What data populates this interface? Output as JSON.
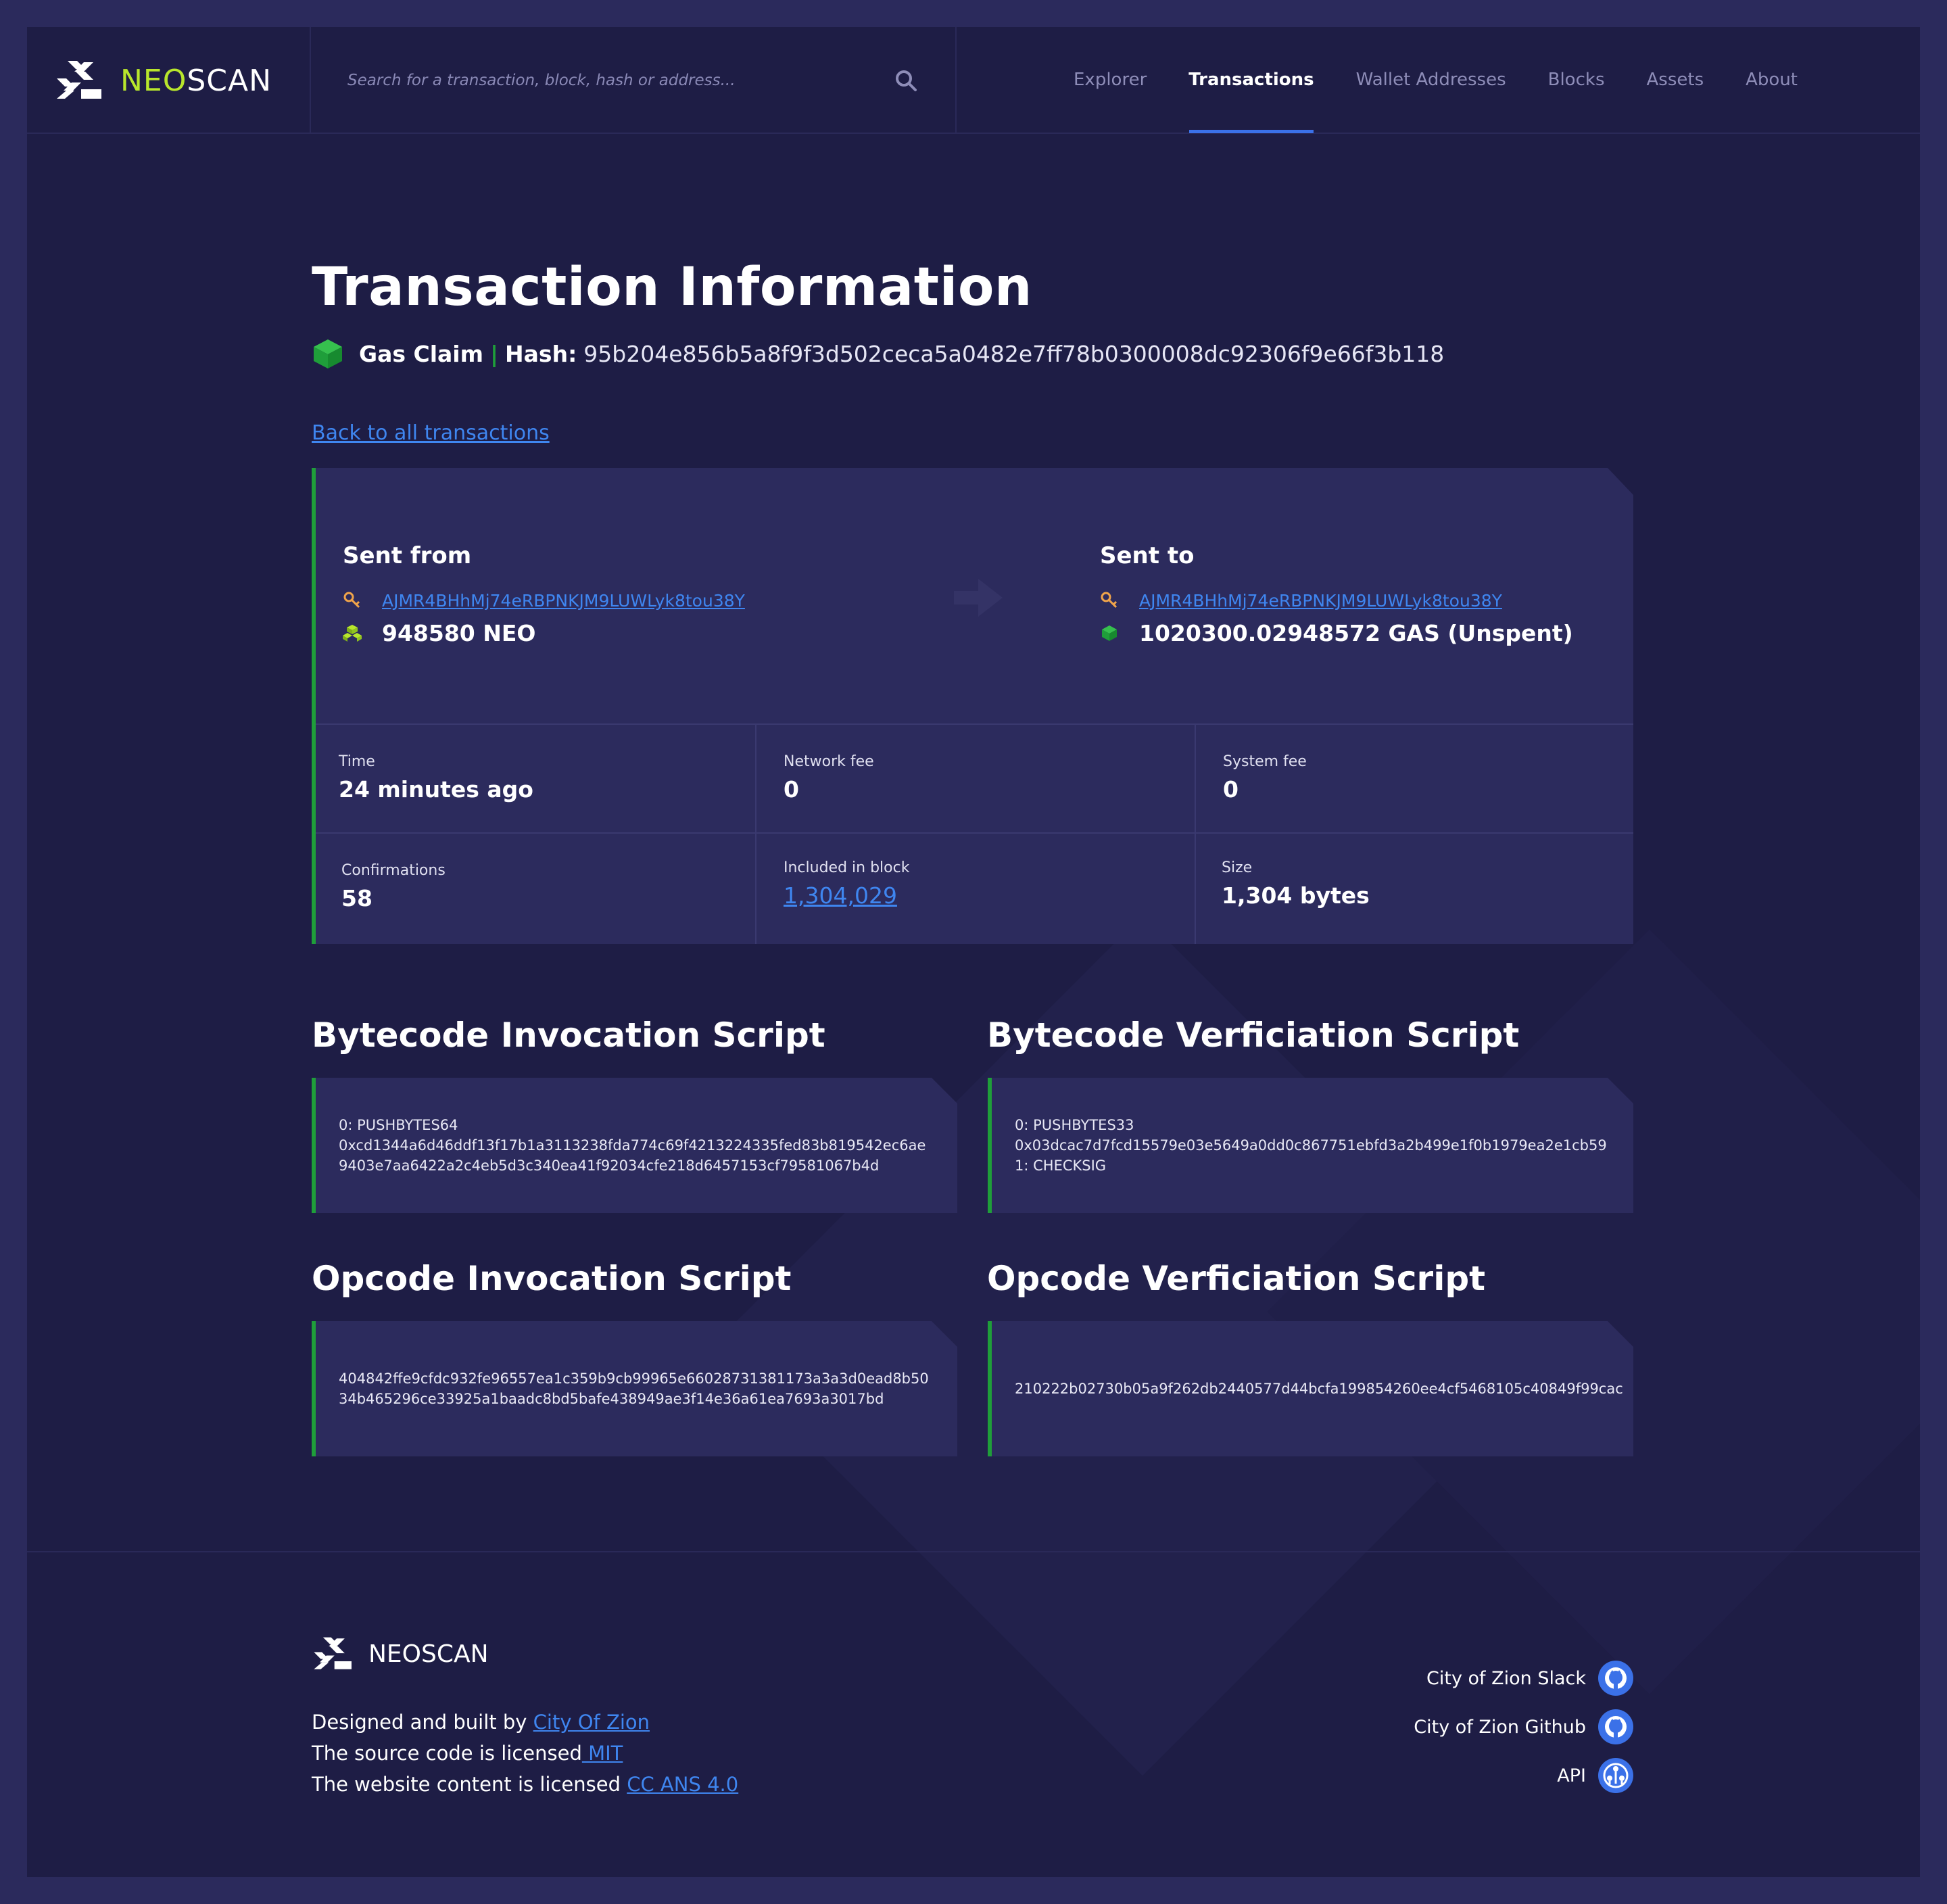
{
  "brand": {
    "neo": "NEO",
    "scan": "SCAN"
  },
  "search": {
    "placeholder": "Search for a transaction, block, hash or address..."
  },
  "nav": [
    {
      "label": "Explorer",
      "active": false
    },
    {
      "label": "Transactions",
      "active": true
    },
    {
      "label": "Wallet Addresses",
      "active": false
    },
    {
      "label": "Blocks",
      "active": false
    },
    {
      "label": "Assets",
      "active": false
    },
    {
      "label": "About",
      "active": false
    }
  ],
  "page": {
    "title": "Transaction Information",
    "type": "Gas Claim",
    "separator": "|",
    "hash_label": "Hash:",
    "hash": "95b204e856b5a8f9f3d502ceca5a0482e7ff78b0300008dc92306f9e66f3b118",
    "back_link": "Back to all transactions"
  },
  "transfer": {
    "from": {
      "label": "Sent from",
      "address": "AJMR4BHhMj74eRBPNKJM9LUWLyk8tou38Y",
      "amount": "948580 NEO"
    },
    "to": {
      "label": "Sent to",
      "address": "AJMR4BHhMj74eRBPNKJM9LUWLyk8tou38Y",
      "amount": "1020300.02948572 GAS (Unspent)"
    }
  },
  "details": {
    "time": {
      "label": "Time",
      "value": "24 minutes ago"
    },
    "network_fee": {
      "label": "Network fee",
      "value": "0"
    },
    "system_fee": {
      "label": "System fee",
      "value": "0"
    },
    "confirmations": {
      "label": "Confirmations",
      "value": "58"
    },
    "block": {
      "label": "Included in block",
      "value": "1,304,029"
    },
    "size": {
      "label": "Size",
      "value": "1,304 bytes"
    }
  },
  "scripts": {
    "bytecode_invocation": {
      "title": "Bytecode Invocation Script",
      "lines": [
        "0: PUSHBYTES64",
        "0xcd1344a6d46ddf13f17b1a3113238fda774c69f4213224335fed83b819542ec6ae",
        "9403e7aa6422a2c4eb5d3c340ea41f92034cfe218d6457153cf79581067b4d"
      ]
    },
    "bytecode_verification": {
      "title": "Bytecode Verficiation Script",
      "lines": [
        "0: PUSHBYTES33",
        "0x03dcac7d7fcd15579e03e5649a0dd0c867751ebfd3a2b499e1f0b1979ea2e1cb59",
        "1: CHECKSIG"
      ]
    },
    "opcode_invocation": {
      "title": "Opcode Invocation Script",
      "lines": [
        "404842ffe9cfdc932fe96557ea1c359b9cb99965e66028731381173a3a3d0ead8b50",
        "34b465296ce33925a1baadc8bd5bafe438949ae3f14e36a61ea7693a3017bd"
      ]
    },
    "opcode_verification": {
      "title": "Opcode Verficiation Script",
      "lines": [
        "210222b02730b05a9f262db2440577d44bcfa199854260ee4cf5468105c40849f99cac"
      ]
    }
  },
  "footer": {
    "brand": "NEOSCAN",
    "designed_prefix": "Designed and built by ",
    "designed_link": "City Of Zion",
    "source_prefix": "The source code is licensed",
    "source_link": " MIT",
    "content_prefix": "The website content is licensed ",
    "content_link": "CC ANS 4.0",
    "links": [
      {
        "label": "City of Zion Slack",
        "icon": "github-icon"
      },
      {
        "label": "City of Zion Github",
        "icon": "github-icon"
      },
      {
        "label": "API",
        "icon": "api-icon"
      }
    ]
  },
  "colors": {
    "accent_green": "#1f9e3a",
    "link_blue": "#3f86f0",
    "brand_lime": "#b8e62c",
    "nav_active_underline": "#3b71e8"
  }
}
